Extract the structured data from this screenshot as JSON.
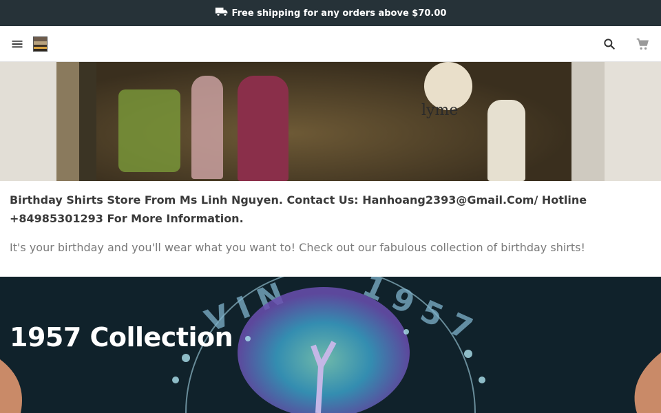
{
  "announcement": {
    "text": "Free shipping for any orders above $70.00",
    "icon": "truck-icon"
  },
  "header": {
    "menu_icon": "menu-icon",
    "logo_alt": "store-logo",
    "search_icon": "search-icon",
    "cart_icon": "cart-icon"
  },
  "intro": {
    "title": "Birthday Shirts Store From Ms Linh Nguyen. Contact Us: Hanhoang2393@Gmail.Com/ Hotline +84985301293 For More Information.",
    "description": "It's your birthday and you'll wear what you want to! Check out our fabulous collection of birthday shirts!"
  },
  "banner": {
    "shop_sign": "lyme"
  },
  "collection": {
    "title": "1957 Collection",
    "shirt_print": "VINTAGE 1957"
  },
  "colors": {
    "topbar_bg": "#263238",
    "collection_bg": "#10222b"
  }
}
